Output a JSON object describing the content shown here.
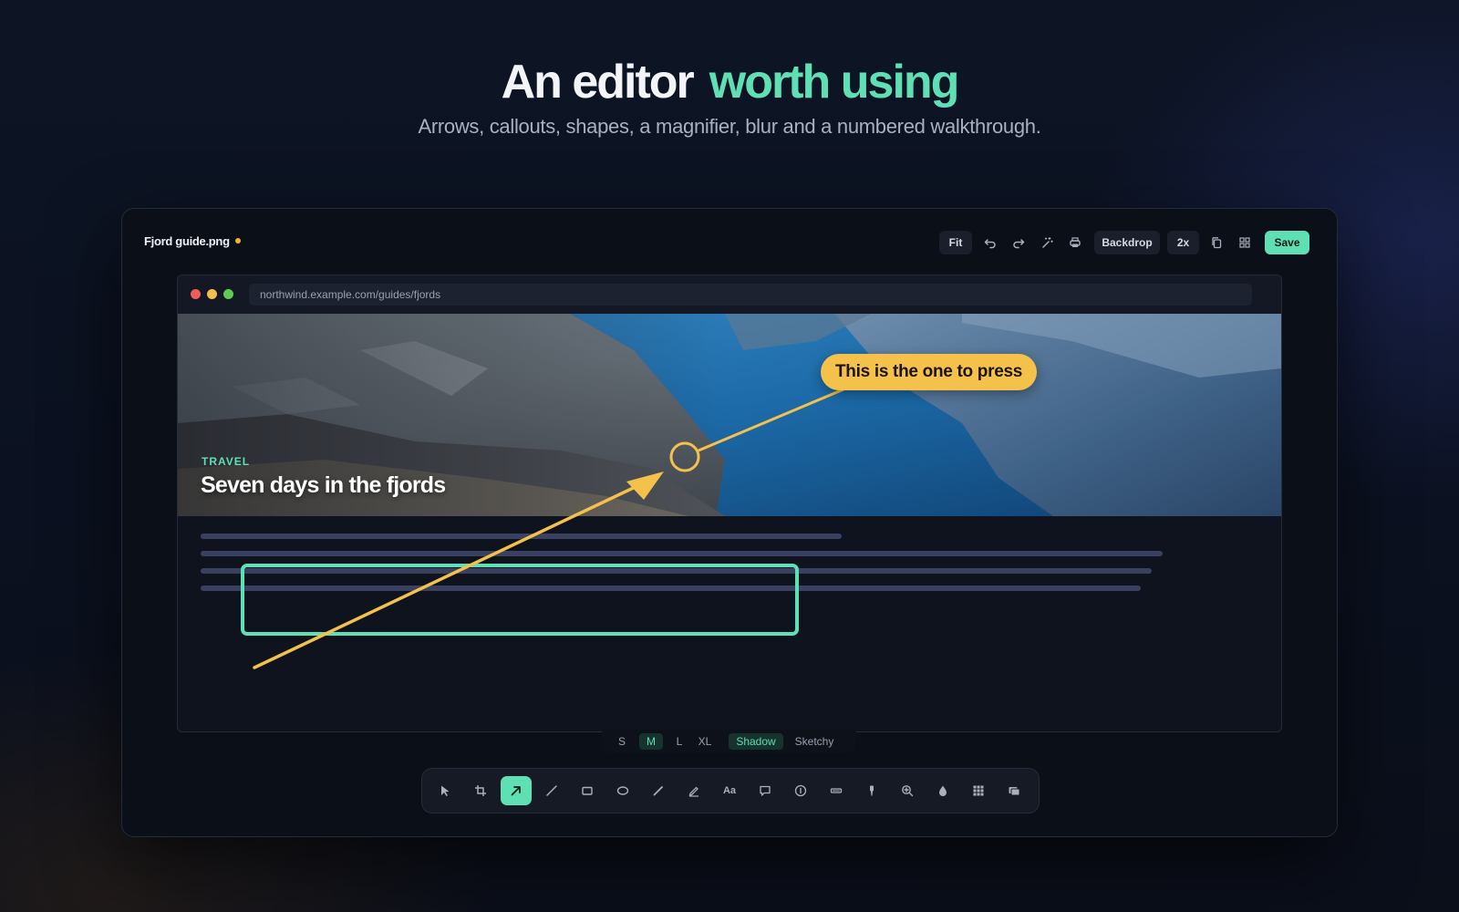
{
  "headline": {
    "part1": "An editor",
    "part2": "worth using"
  },
  "subheadline": "Arrows, callouts, shapes, a magnifier, blur and a numbered walkthrough.",
  "editor": {
    "file_name": "Fjord guide.png",
    "toolbar": {
      "fit_label": "Fit",
      "backdrop_label": "Backdrop",
      "scale_label": "2x",
      "save_label": "Save",
      "icons": [
        "undo-icon",
        "redo-icon",
        "magic-wand-icon",
        "printer-icon",
        "copy-icon",
        "grid-icon"
      ]
    }
  },
  "canvas": {
    "url": "northwind.example.com/guides/fjords",
    "kicker": "TRAVEL",
    "article_title": "Seven days in the fjords",
    "callout_text": "This is the one to press"
  },
  "size_options": {
    "items": [
      "S",
      "M",
      "L",
      "XL",
      "Shadow",
      "Sketchy"
    ],
    "selected_size": "M",
    "shadow_enabled": true
  },
  "tools": {
    "items": [
      "select-icon",
      "crop-icon",
      "arrow-icon",
      "line-icon",
      "rectangle-icon",
      "ellipse-icon",
      "pen-icon",
      "highlighter-icon",
      "text-tool",
      "speech-bubble-icon",
      "step-number-icon",
      "redact-bar-icon",
      "marker-icon",
      "magnifier-icon",
      "blur-drop-icon",
      "pixelate-grid-icon",
      "layers-icon"
    ],
    "text_tool_label": "Aa",
    "active": "arrow-icon"
  },
  "colors": {
    "accent": "#5fdfb4",
    "callout": "#f4c14b",
    "unsaved_dot": "#f2b33d"
  }
}
